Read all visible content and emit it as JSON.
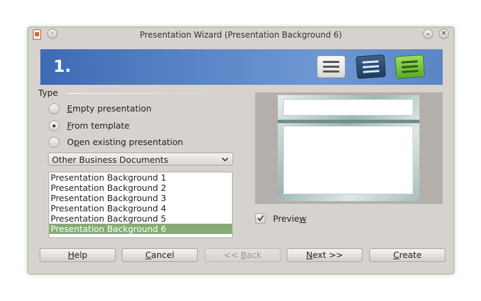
{
  "window": {
    "title": "Presentation Wizard (Presentation Background 6)",
    "menu_glyph": "◦",
    "minimize_glyph": "⌄",
    "close_glyph": "✕"
  },
  "banner": {
    "step": "1.",
    "icons": [
      "list-icon",
      "list-blue-icon",
      "list-green-icon"
    ]
  },
  "type_section": {
    "label": "Type",
    "options": [
      {
        "pre": "",
        "key": "E",
        "post": "mpty presentation",
        "checked": false
      },
      {
        "pre": "",
        "key": "F",
        "post": "rom template",
        "checked": true
      },
      {
        "pre": "O",
        "key": "p",
        "post": "en existing presentation",
        "checked": false
      }
    ]
  },
  "template_category": {
    "selected": "Other Business Documents"
  },
  "template_list": {
    "items": [
      "Presentation Background 1",
      "Presentation Background 2",
      "Presentation Background 3",
      "Presentation Background 4",
      "Presentation Background 5",
      "Presentation Background 6"
    ],
    "selected_index": 5
  },
  "preview": {
    "checked": true,
    "label_pre": "Previe",
    "label_key": "w"
  },
  "buttons": {
    "help": {
      "key": "H",
      "rest": "elp",
      "enabled": true
    },
    "cancel": {
      "key": "C",
      "rest": "ancel",
      "enabled": true
    },
    "back": {
      "pre": "<< ",
      "key": "B",
      "rest": "ack",
      "enabled": false
    },
    "next": {
      "key": "N",
      "rest": "ext >>",
      "enabled": true
    },
    "create": {
      "key": "C",
      "rest": "reate",
      "enabled": true
    }
  },
  "colors": {
    "banner_start": "#3d6ab3",
    "selection": "#86ab75",
    "window_bg": "#d6d2cd"
  }
}
